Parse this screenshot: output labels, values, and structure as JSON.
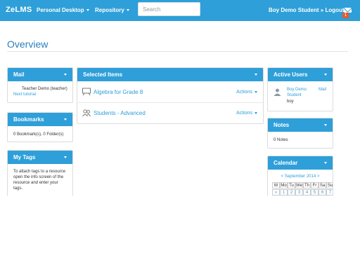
{
  "header": {
    "brand": "ZeLMS",
    "nav": [
      {
        "label": "Personal Desktop"
      },
      {
        "label": "Repository"
      }
    ],
    "search_placeholder": "Search",
    "user": "Boy Demo Student » Logout",
    "mail_count": "1"
  },
  "page": {
    "title": "Overview"
  },
  "mail": {
    "title": "Mail",
    "from": "Teacher Demo (teacher)",
    "subject": "Next tutorial"
  },
  "bookmarks": {
    "title": "Bookmarks",
    "summary": "0 Bookmark(s), 0 Folder(s)"
  },
  "tags": {
    "title": "My Tags",
    "text": "To attach tags to a resource open the info screen of the resource and enter your tags."
  },
  "selected": {
    "title": "Selected Items",
    "items": [
      {
        "label": "Algebra for Grade 8",
        "icon": "course-icon",
        "actions": "Actions"
      },
      {
        "label": "Students - Advanced",
        "icon": "group-icon",
        "actions": "Actions"
      }
    ]
  },
  "active_users": {
    "title": "Active Users",
    "name_line1": "Boy Demo",
    "name_line2": "Student",
    "login": "boy",
    "mail_link": "Mail"
  },
  "notes": {
    "title": "Notes",
    "summary": "0 Notes"
  },
  "calendar": {
    "title": "Calendar",
    "month": "< September 2014 >",
    "weekdays": [
      "W",
      "Mo",
      "Tu",
      "We",
      "Th",
      "Fr",
      "Sa",
      "Su"
    ],
    "first_row": [
      "»",
      "1",
      "2",
      "3",
      "4",
      "5",
      "6",
      "7"
    ]
  }
}
